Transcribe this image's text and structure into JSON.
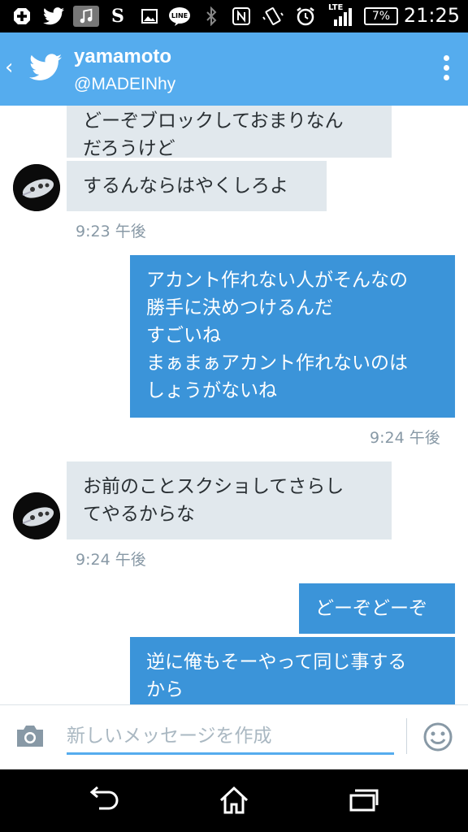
{
  "status_bar": {
    "time": "21:25",
    "battery": "7%",
    "network": "LTE",
    "icons": [
      "add-icon",
      "twitter-icon",
      "music-icon",
      "s-app-icon",
      "image-icon",
      "line-icon",
      "bluetooth-icon",
      "nfc-icon",
      "vibrate-icon",
      "alarm-icon",
      "signal-icon",
      "battery-icon"
    ]
  },
  "header": {
    "name": "yamamoto",
    "handle": "@MADEINhy",
    "accent": "#55acee"
  },
  "messages": [
    {
      "dir": "in",
      "lines": [
        "どーぞブロックしておまりなん",
        "だろうけど"
      ]
    },
    {
      "dir": "in",
      "lines": [
        "するんならはやくしろよ"
      ]
    },
    {
      "dir": "ts",
      "text": "9:23 午後"
    },
    {
      "dir": "out",
      "lines": [
        "アカント作れない人がそんなの",
        "勝手に決めつけるんだ",
        "すごいね",
        "まぁまぁアカント作れないのは",
        "しょうがないね"
      ]
    },
    {
      "dir": "ts",
      "text": "9:24 午後"
    },
    {
      "dir": "in",
      "lines": [
        "お前のことスクショしてさらし",
        "てやるからな"
      ]
    },
    {
      "dir": "ts",
      "text": "9:24 午後"
    },
    {
      "dir": "out",
      "lines": [
        "どーぞどーぞ"
      ]
    },
    {
      "dir": "out",
      "lines": [
        "逆に俺もそーやって同じ事する",
        "から"
      ]
    }
  ],
  "composer": {
    "placeholder": "新しいメッセージを作成"
  },
  "colors": {
    "incoming_bubble": "#e1e8ed",
    "outgoing_bubble": "#3b94d9"
  }
}
